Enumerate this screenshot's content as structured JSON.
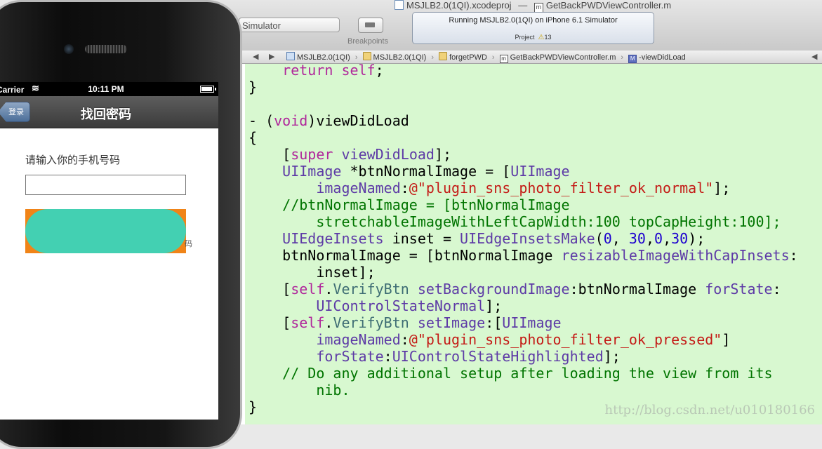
{
  "xcode": {
    "window_title_project": "MSJLB2.0(1QI).xcodeproj",
    "window_title_sep": "—",
    "window_title_file": "GetBackPWDViewController.m",
    "scheme_partial": "Simulator",
    "breakpoints_label": "Breakpoints",
    "activity_main": "Running MSJLB2.0(1QI) on iPhone 6.1 Simulator",
    "activity_project_label": "Project",
    "activity_warning_count": "13",
    "jumpbar": {
      "back": "◀",
      "forward": "▶",
      "crumbs": [
        "MSJLB2.0(1QI)",
        "MSJLB2.0(1QI)",
        "forgetPWD",
        "GetBackPWDViewController.m",
        "-viewDidLoad"
      ]
    }
  },
  "watermark": "http://blog.csdn.net/u010180166",
  "simulator": {
    "carrier": "Carrier",
    "time": "10:11 PM",
    "back_label": "登录",
    "nav_title": "找回密码",
    "prompt": "请输入你的手机号码",
    "input_value": "",
    "clipped_glyph": "码"
  },
  "colors": {
    "editor_bg": "#d8f8d0",
    "button_pill": "#43d0b2",
    "button_bg": "#f08418"
  }
}
